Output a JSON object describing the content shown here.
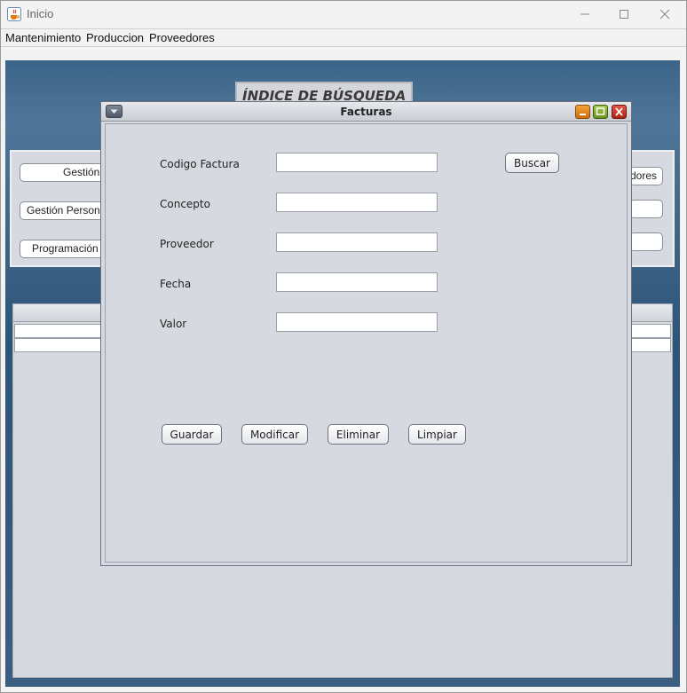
{
  "window": {
    "title": "Inicio",
    "icon": "java-cup-icon"
  },
  "menu": [
    "Mantenimiento",
    "Produccion",
    "Proveedores"
  ],
  "background": {
    "banner_title": "ÍNDICE DE BÚSQUEDA",
    "buttons": [
      "Gestión",
      "Gestión Person",
      "Programación",
      "dores"
    ]
  },
  "internal_frame": {
    "title": "Facturas",
    "fields": [
      {
        "label": "Codigo Factura",
        "value": ""
      },
      {
        "label": "Concepto",
        "value": ""
      },
      {
        "label": "Proveedor",
        "value": ""
      },
      {
        "label": "Fecha",
        "value": ""
      },
      {
        "label": "Valor",
        "value": ""
      }
    ],
    "search_button": "Buscar",
    "actions": [
      "Guardar",
      "Modificar",
      "Eliminar",
      "Limpiar"
    ]
  },
  "colors": {
    "desktop": "#2e5478",
    "frame": "#d6d9df",
    "minimize": "#e07b12",
    "maximize": "#7aa52a",
    "close": "#c93a2c"
  }
}
